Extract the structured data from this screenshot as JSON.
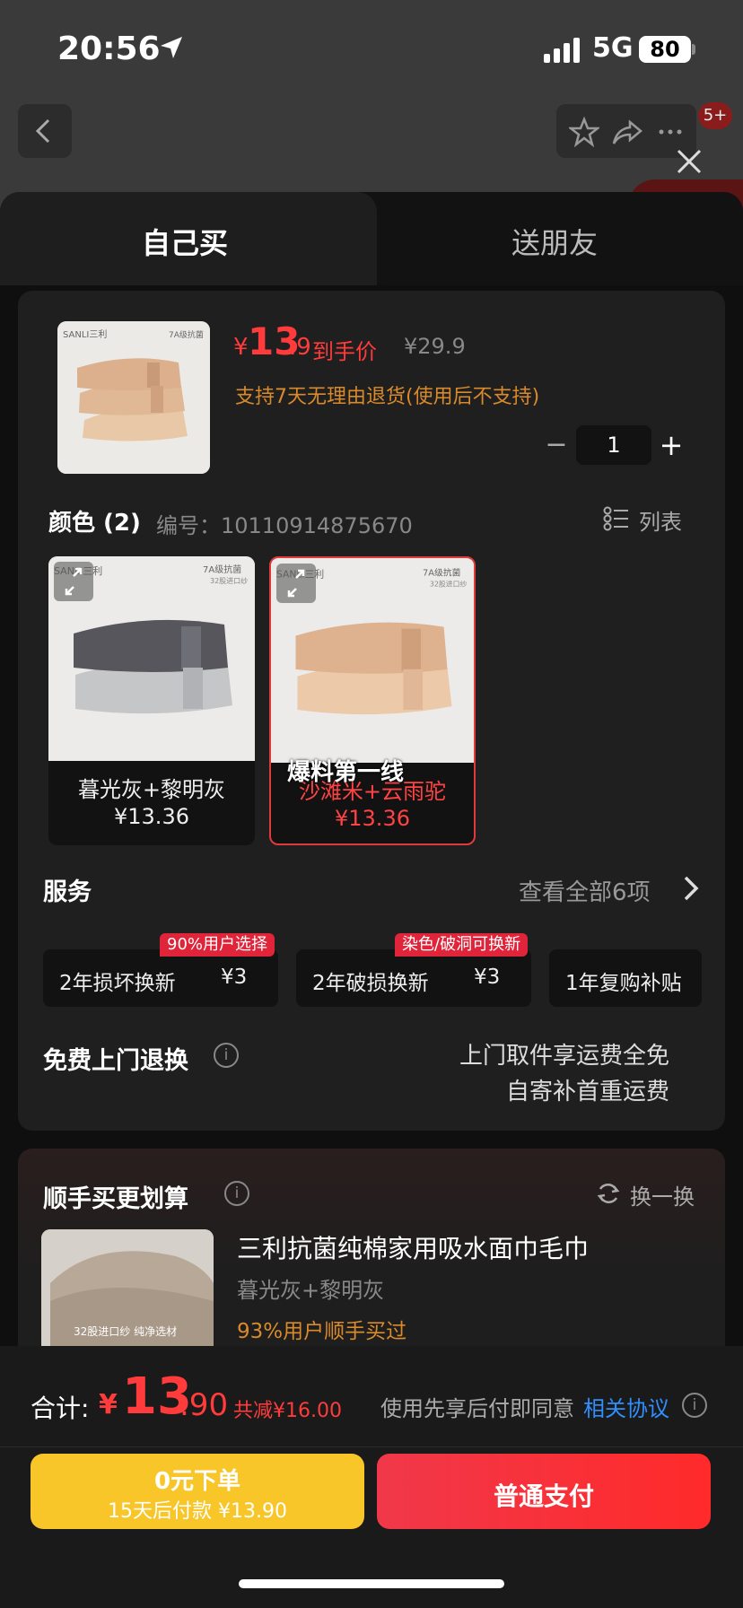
{
  "status_bar": {
    "time": "20:56",
    "network": "5G",
    "battery": "80"
  },
  "nav": {
    "badge": "5+"
  },
  "tabs": {
    "self": "自己买",
    "gift": "送朋友"
  },
  "product": {
    "thumb_brand": "SANLI三利",
    "thumb_tag": "7A级抗菌",
    "price_currency": "¥",
    "price_int": "13",
    "price_dec": ".9",
    "price_tag": "到手价",
    "original_price": "¥29.9",
    "return_policy": "支持7天无理由退货(使用后不支持)",
    "quantity": "1"
  },
  "color": {
    "title": "颜色 (2)",
    "code": "编号：10110914875670",
    "list_label": "列表",
    "variants": [
      {
        "name": "暮光灰+黎明灰",
        "price": "¥13.36",
        "brand": "SANLI三利",
        "tag": "7A级抗菌",
        "subtag": "32股进口纱"
      },
      {
        "name": "沙滩米+云雨驼",
        "price": "¥13.36",
        "brand": "SANLI三利",
        "tag": "7A级抗菌",
        "subtag": "32股进口纱"
      }
    ],
    "overlay": "爆料第一线"
  },
  "service": {
    "title": "服务",
    "view_all": "查看全部6项",
    "items": [
      {
        "name": "2年损坏换新",
        "price": "¥3",
        "tag": "90%用户选择"
      },
      {
        "name": "2年破损换新",
        "price": "¥3",
        "tag": "染色/破洞可换新"
      },
      {
        "name": "1年复购补贴",
        "price": ""
      }
    ]
  },
  "free_return": {
    "title": "免费上门退换",
    "line1": "上门取件享运费全免",
    "line2": "自寄补首重运费"
  },
  "extra": {
    "title": "顺手买更划算",
    "swap": "换一换",
    "product_name": "三利抗菌纯棉家用吸水面巾毛巾",
    "variant": "暮光灰+黎明灰",
    "stat": "93%用户顺手买过",
    "thumb_caption": "32股进口纱 纯净选材"
  },
  "bottom": {
    "sum_label": "合计:",
    "currency": "¥",
    "total_int": "13",
    "total_dec": ".90",
    "discount": "共减¥16.00",
    "agree_text": "使用先享后付即同意",
    "agree_link": "相关协议",
    "later_line1": "0元下单",
    "later_line2": "15天后付款 ¥13.90",
    "pay_label": "普通支付"
  },
  "colors": {
    "accent_red": "#ff3b3b",
    "orange": "#d98a2b",
    "yellow_button": "#f8c629",
    "link_blue": "#2f8fff"
  }
}
